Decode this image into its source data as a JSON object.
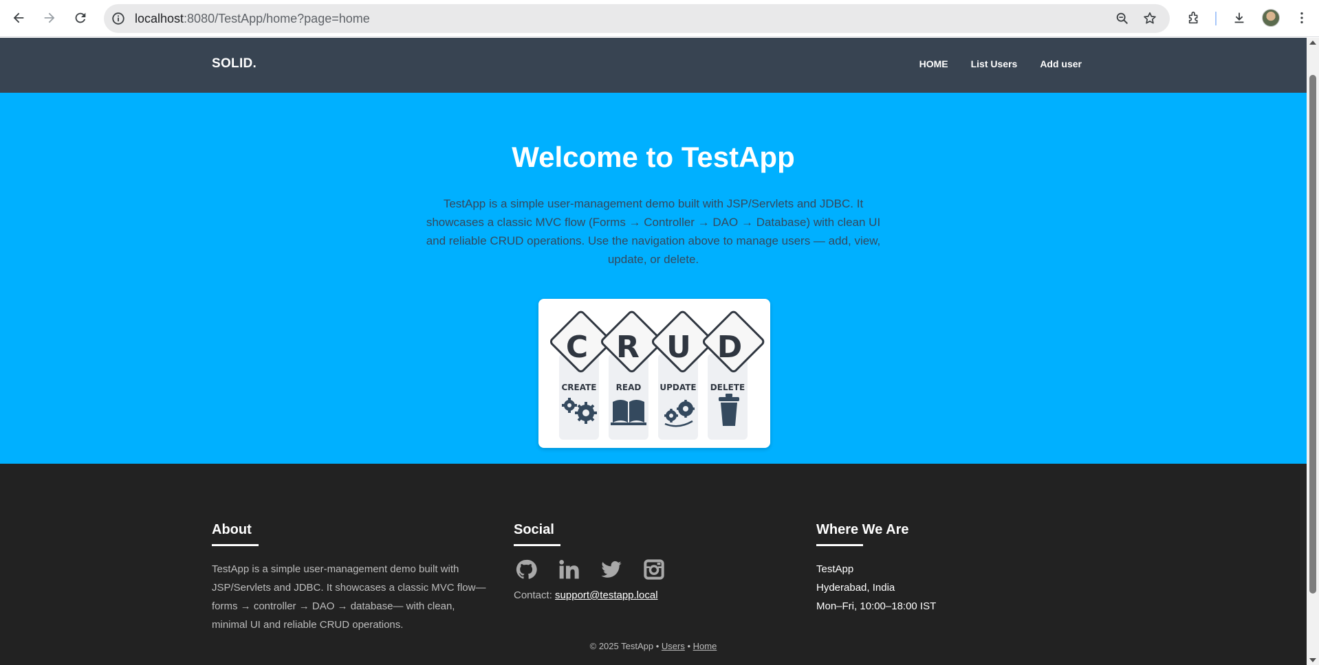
{
  "browser": {
    "url_host": "localhost",
    "url_path": ":8080/TestApp/home?page=home"
  },
  "header": {
    "brand": "SOLID.",
    "nav": [
      "HOME",
      "List Users",
      "Add user"
    ]
  },
  "hero": {
    "title": "Welcome to TestApp",
    "description": "TestApp is a simple user-management demo built with JSP/Servlets and JDBC. It showcases a classic MVC flow (Forms → Controller → DAO → Database) with clean UI and reliable CRUD operations. Use the navigation above to manage users — add, view, update, or delete.",
    "crud_letters": [
      "C",
      "R",
      "U",
      "D"
    ],
    "crud_words": [
      "CREATE",
      "READ",
      "UPDATE",
      "DELETE"
    ]
  },
  "footer": {
    "about": {
      "title": "About",
      "text": "TestApp is a simple user-management demo built with JSP/Servlets and JDBC. It showcases a classic MVC flow—forms → controller → DAO → database— with clean, minimal UI and reliable CRUD operations."
    },
    "social": {
      "title": "Social",
      "icons": [
        "github-icon",
        "linkedin-icon",
        "twitter-icon",
        "instagram-icon"
      ],
      "contact_label": "Contact:",
      "contact_email": "support@testapp.local"
    },
    "where": {
      "title": "Where We Are",
      "lines": [
        "TestApp",
        "Hyderabad, India",
        "Mon–Fri, 10:00–18:00 IST"
      ]
    },
    "copyright_prefix": "© 2025 TestApp •",
    "link_users": "Users",
    "separator": "•",
    "link_home": "Home"
  },
  "colors": {
    "header_bg": "#384452",
    "hero_bg": "#00b0ff",
    "footer_bg": "#222222"
  }
}
